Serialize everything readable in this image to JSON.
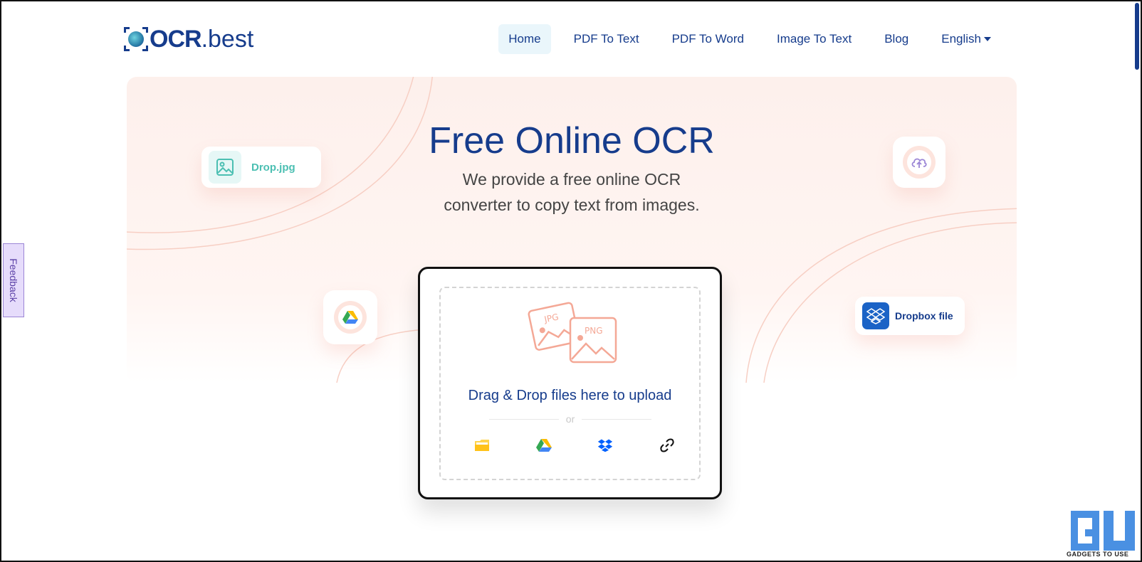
{
  "header": {
    "logo_strong": "OCR",
    "logo_light": ".best",
    "nav": [
      {
        "label": "Home",
        "active": true
      },
      {
        "label": "PDF To Text",
        "active": false
      },
      {
        "label": "PDF To Word",
        "active": false
      },
      {
        "label": "Image To Text",
        "active": false
      },
      {
        "label": "Blog",
        "active": false
      },
      {
        "label": "English",
        "active": false,
        "dropdown": true
      }
    ]
  },
  "hero": {
    "title": "Free Online OCR",
    "subtitle_line1": "We provide a free online OCR",
    "subtitle_line2": "converter to copy text from images.",
    "chips": {
      "drop_jpg": "Drop.jpg",
      "dropbox_file": "Dropbox file"
    }
  },
  "upload": {
    "art_labels": [
      "JPG",
      "PNG"
    ],
    "drag_text": "Drag & Drop files here to upload",
    "or_text": "or",
    "sources": [
      {
        "icon": "folder-icon"
      },
      {
        "icon": "google-drive-icon"
      },
      {
        "icon": "dropbox-icon"
      },
      {
        "icon": "link-icon"
      }
    ]
  },
  "feedback": {
    "label": "Feedback"
  },
  "watermark": {
    "label": "GADGETS TO USE"
  },
  "colors": {
    "brand": "#163c8c",
    "hero_bg": "#fdf0ec",
    "accent_pink": "#f4a896",
    "teal": "#4bbfb2",
    "dropbox_blue": "#1b63c6"
  }
}
